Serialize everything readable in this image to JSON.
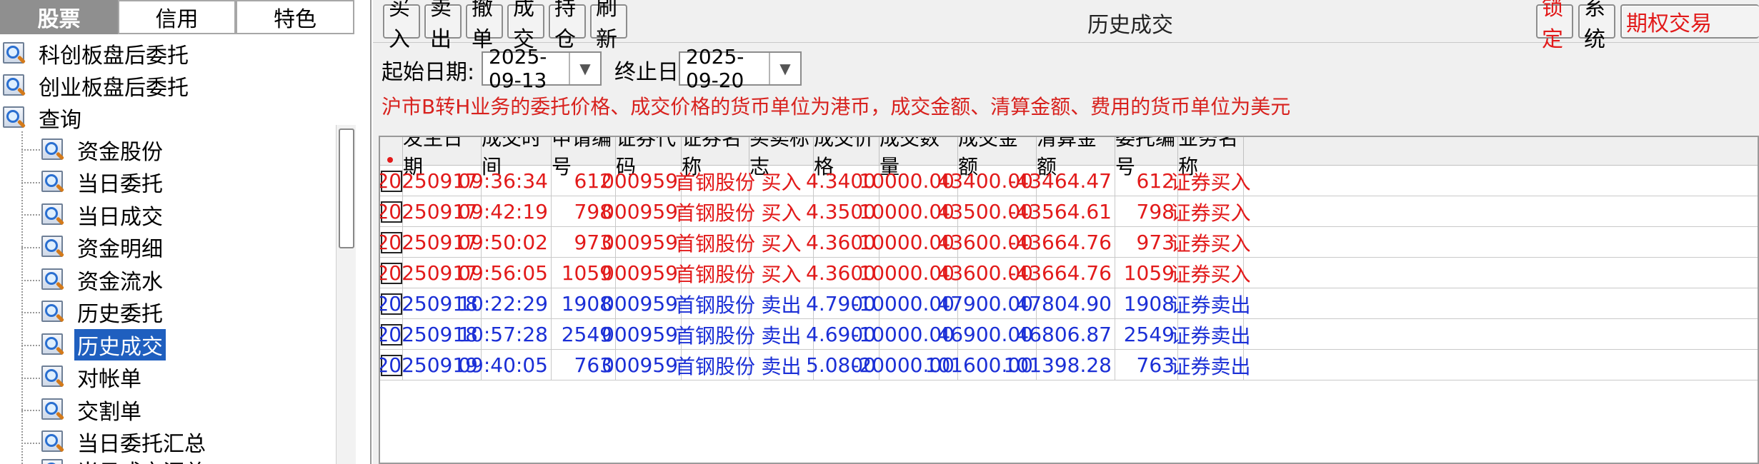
{
  "tabs": [
    "股票",
    "信用",
    "特色"
  ],
  "tree": {
    "top_items": [
      "科创板盘后委托",
      "创业板盘后委托",
      "查询"
    ],
    "children": [
      "资金股份",
      "当日委托",
      "当日成交",
      "资金明细",
      "资金流水",
      "历史委托",
      "历史成交",
      "对帐单",
      "交割单",
      "当日委托汇总",
      "当日成交汇总"
    ],
    "selected": "历史成交"
  },
  "toolbar": {
    "buttons": [
      "买入",
      "卖出",
      "撤单",
      "成交",
      "持仓",
      "刷新"
    ],
    "title": "历史成交",
    "right_buttons": [
      "锁定",
      "系统",
      "期权交易"
    ]
  },
  "filter": {
    "start_label": "起始日期:",
    "start_value": "2025-09-13",
    "end_label": "终止日期:",
    "end_value": "2025-09-20",
    "notice": "沪市B转H业务的委托价格、成交价格的货币单位为港币，成交金额、清算金额、费用的货币单位为美元"
  },
  "colors": {
    "buy": "#e21a1a",
    "sell": "#1b2fd6",
    "selected": "#1f5fbf"
  },
  "table": {
    "columns": [
      "发生日期",
      "成交时间",
      "申请编号",
      "证券代码",
      "证券名称",
      "买卖标志",
      "成交价格",
      "成交数量",
      "成交金额",
      "清算金额",
      "委托编号",
      "业务名称"
    ],
    "rows": [
      {
        "side": "buy",
        "cells": [
          "20250917",
          "09:36:34",
          "612",
          "000959",
          "首钢股份",
          "买入",
          "4.3400",
          "10000.00",
          "43400.00",
          "-43464.47",
          "612",
          "证券买入"
        ]
      },
      {
        "side": "buy",
        "cells": [
          "20250917",
          "09:42:19",
          "798",
          "000959",
          "首钢股份",
          "买入",
          "4.3500",
          "10000.00",
          "43500.00",
          "-43564.61",
          "798",
          "证券买入"
        ]
      },
      {
        "side": "buy",
        "cells": [
          "20250917",
          "09:50:02",
          "973",
          "000959",
          "首钢股份",
          "买入",
          "4.3600",
          "10000.00",
          "43600.00",
          "-43664.76",
          "973",
          "证券买入"
        ]
      },
      {
        "side": "buy",
        "cells": [
          "20250917",
          "09:56:05",
          "1059",
          "000959",
          "首钢股份",
          "买入",
          "4.3600",
          "10000.00",
          "43600.00",
          "-43664.76",
          "1059",
          "证券买入"
        ]
      },
      {
        "side": "sell",
        "cells": [
          "20250918",
          "10:22:29",
          "1908",
          "000959",
          "首钢股份",
          "卖出",
          "4.7900",
          "-10000.00",
          "47900.00",
          "47804.90",
          "1908",
          "证券卖出"
        ]
      },
      {
        "side": "sell",
        "cells": [
          "20250918",
          "10:57:28",
          "2549",
          "000959",
          "首钢股份",
          "卖出",
          "4.6900",
          "-10000.00",
          "46900.00",
          "46806.87",
          "2549",
          "证券卖出"
        ]
      },
      {
        "side": "sell",
        "cells": [
          "20250919",
          "09:40:05",
          "763",
          "000959",
          "首钢股份",
          "卖出",
          "5.0800",
          "-20000.00",
          "101600.00",
          "101398.28",
          "763",
          "证券卖出"
        ]
      }
    ]
  }
}
